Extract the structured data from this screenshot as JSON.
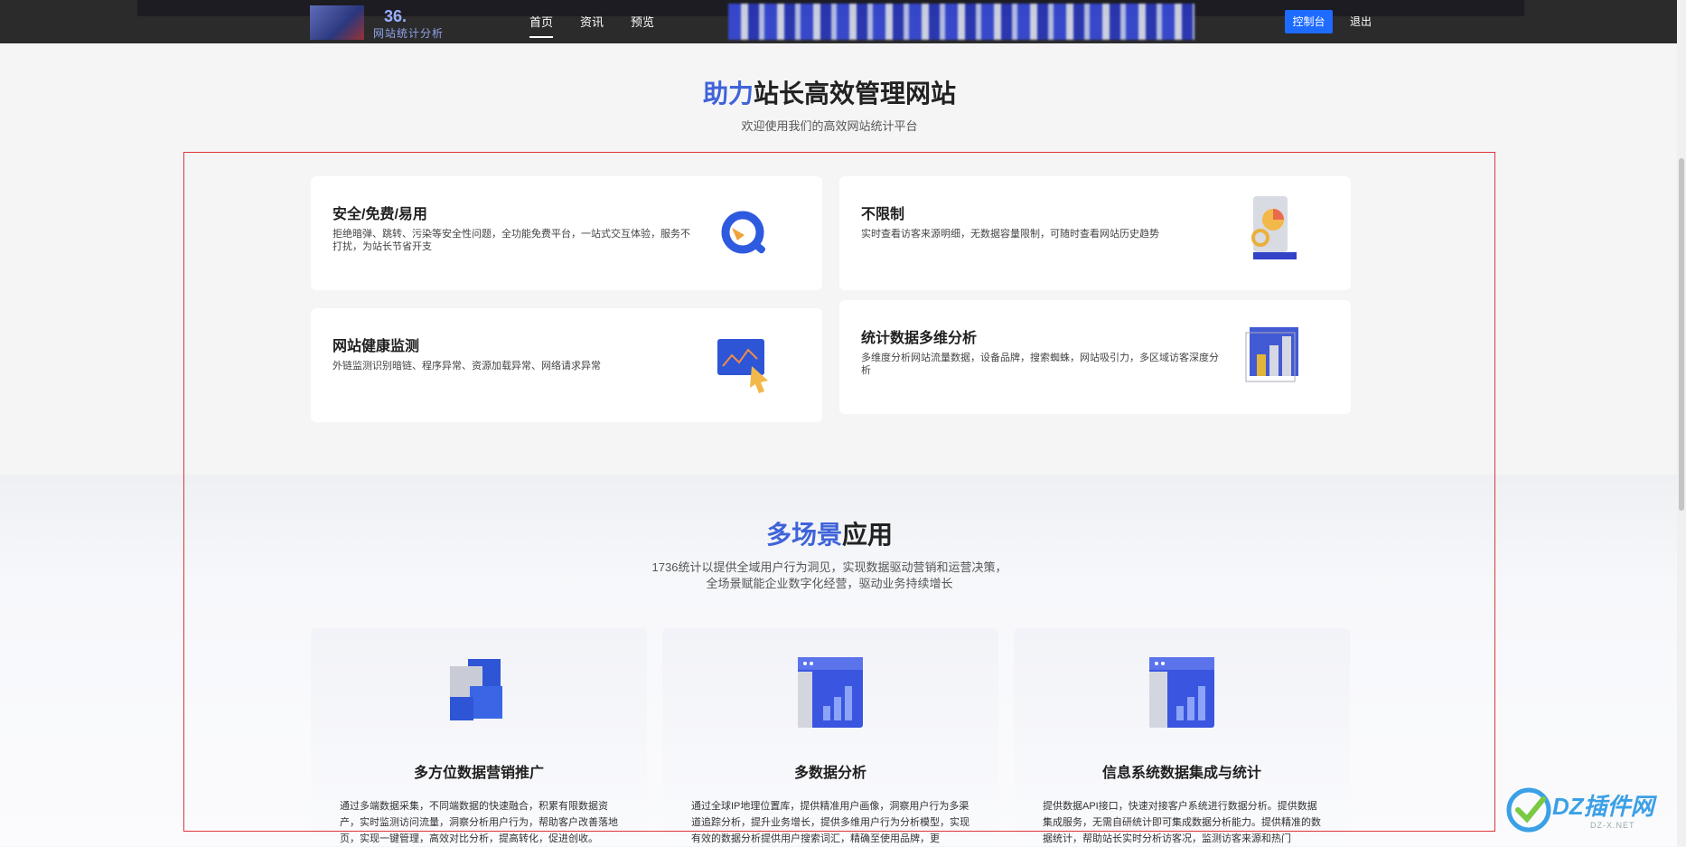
{
  "nav": {
    "logo_number": "36.",
    "logo_subtitle": "网站统计分析",
    "links": [
      "首页",
      "资讯",
      "预览"
    ],
    "console_button": "控制台",
    "logout": "退出"
  },
  "hero": {
    "title_highlight": "助力",
    "title_rest": "站长高效管理网站",
    "subtitle": "欢迎使用我们的高效网站统计平台"
  },
  "features": [
    {
      "title": "安全/免费/易用",
      "desc": "拒绝暗弹、跳转、污染等安全性问题，全功能免费平台，一站式交互体验，服务不打扰，为站长节省开支",
      "icon": "search-q-icon"
    },
    {
      "title": "不限制",
      "desc": "实时查看访客来源明细，无数据容量限制，可随时查看网站历史趋势",
      "icon": "pie-report-icon"
    },
    {
      "title": "网站健康监测",
      "desc": "外链监测识别暗链、程序异常、资源加载异常、网络请求异常",
      "icon": "monitor-chart-icon"
    },
    {
      "title": "统计数据多维分析",
      "desc": "多维度分析网站流量数据，设备品牌，搜索蜘蛛，网站吸引力，多区域访客深度分析",
      "icon": "bar-cube-icon"
    }
  ],
  "scenes": {
    "title_highlight": "多场景",
    "title_rest": "应用",
    "desc_line1": "1736统计以提供全域用户行为洞见，实现数据驱动营销和运营决策，",
    "desc_line2": "全场景赋能企业数字化经营，驱动业务持续增长",
    "cards": [
      {
        "title": "多方位数据营销推广",
        "desc": "通过多端数据采集，不同端数据的快速融合，积累有限数据资产，实时监测访问流量，洞察分析用户行为，帮助客户改善落地页，实现一键管理，高效对比分析，提高转化，促进创收。",
        "icon": "cubes-icon"
      },
      {
        "title": "多数据分析",
        "desc": "通过全球IP地理位置库，提供精准用户画像，洞察用户行为多渠道追踪分析，提升业务增长，提供多维用户行为分析模型，实现有效的数据分析提供用户搜索词汇，精确至使用品牌，更",
        "icon": "dashboard-window-icon"
      },
      {
        "title": "信息系统数据集成与统计",
        "desc": "提供数据API接口，快速对接客户系统进行数据分析。提供数据集成服务，无需自研统计即可集成数据分析能力。提供精准的数据统计，帮助站长实时分析访客况，监测访客来源和热门",
        "icon": "integration-window-icon"
      }
    ]
  },
  "watermark": {
    "text": "DZ插件网",
    "sub": "DZ-X.NET"
  },
  "colors": {
    "accent": "#3f63d9",
    "button": "#1e6bff",
    "nav": "#2b2b2b",
    "highlight_box": "#e0353a"
  }
}
